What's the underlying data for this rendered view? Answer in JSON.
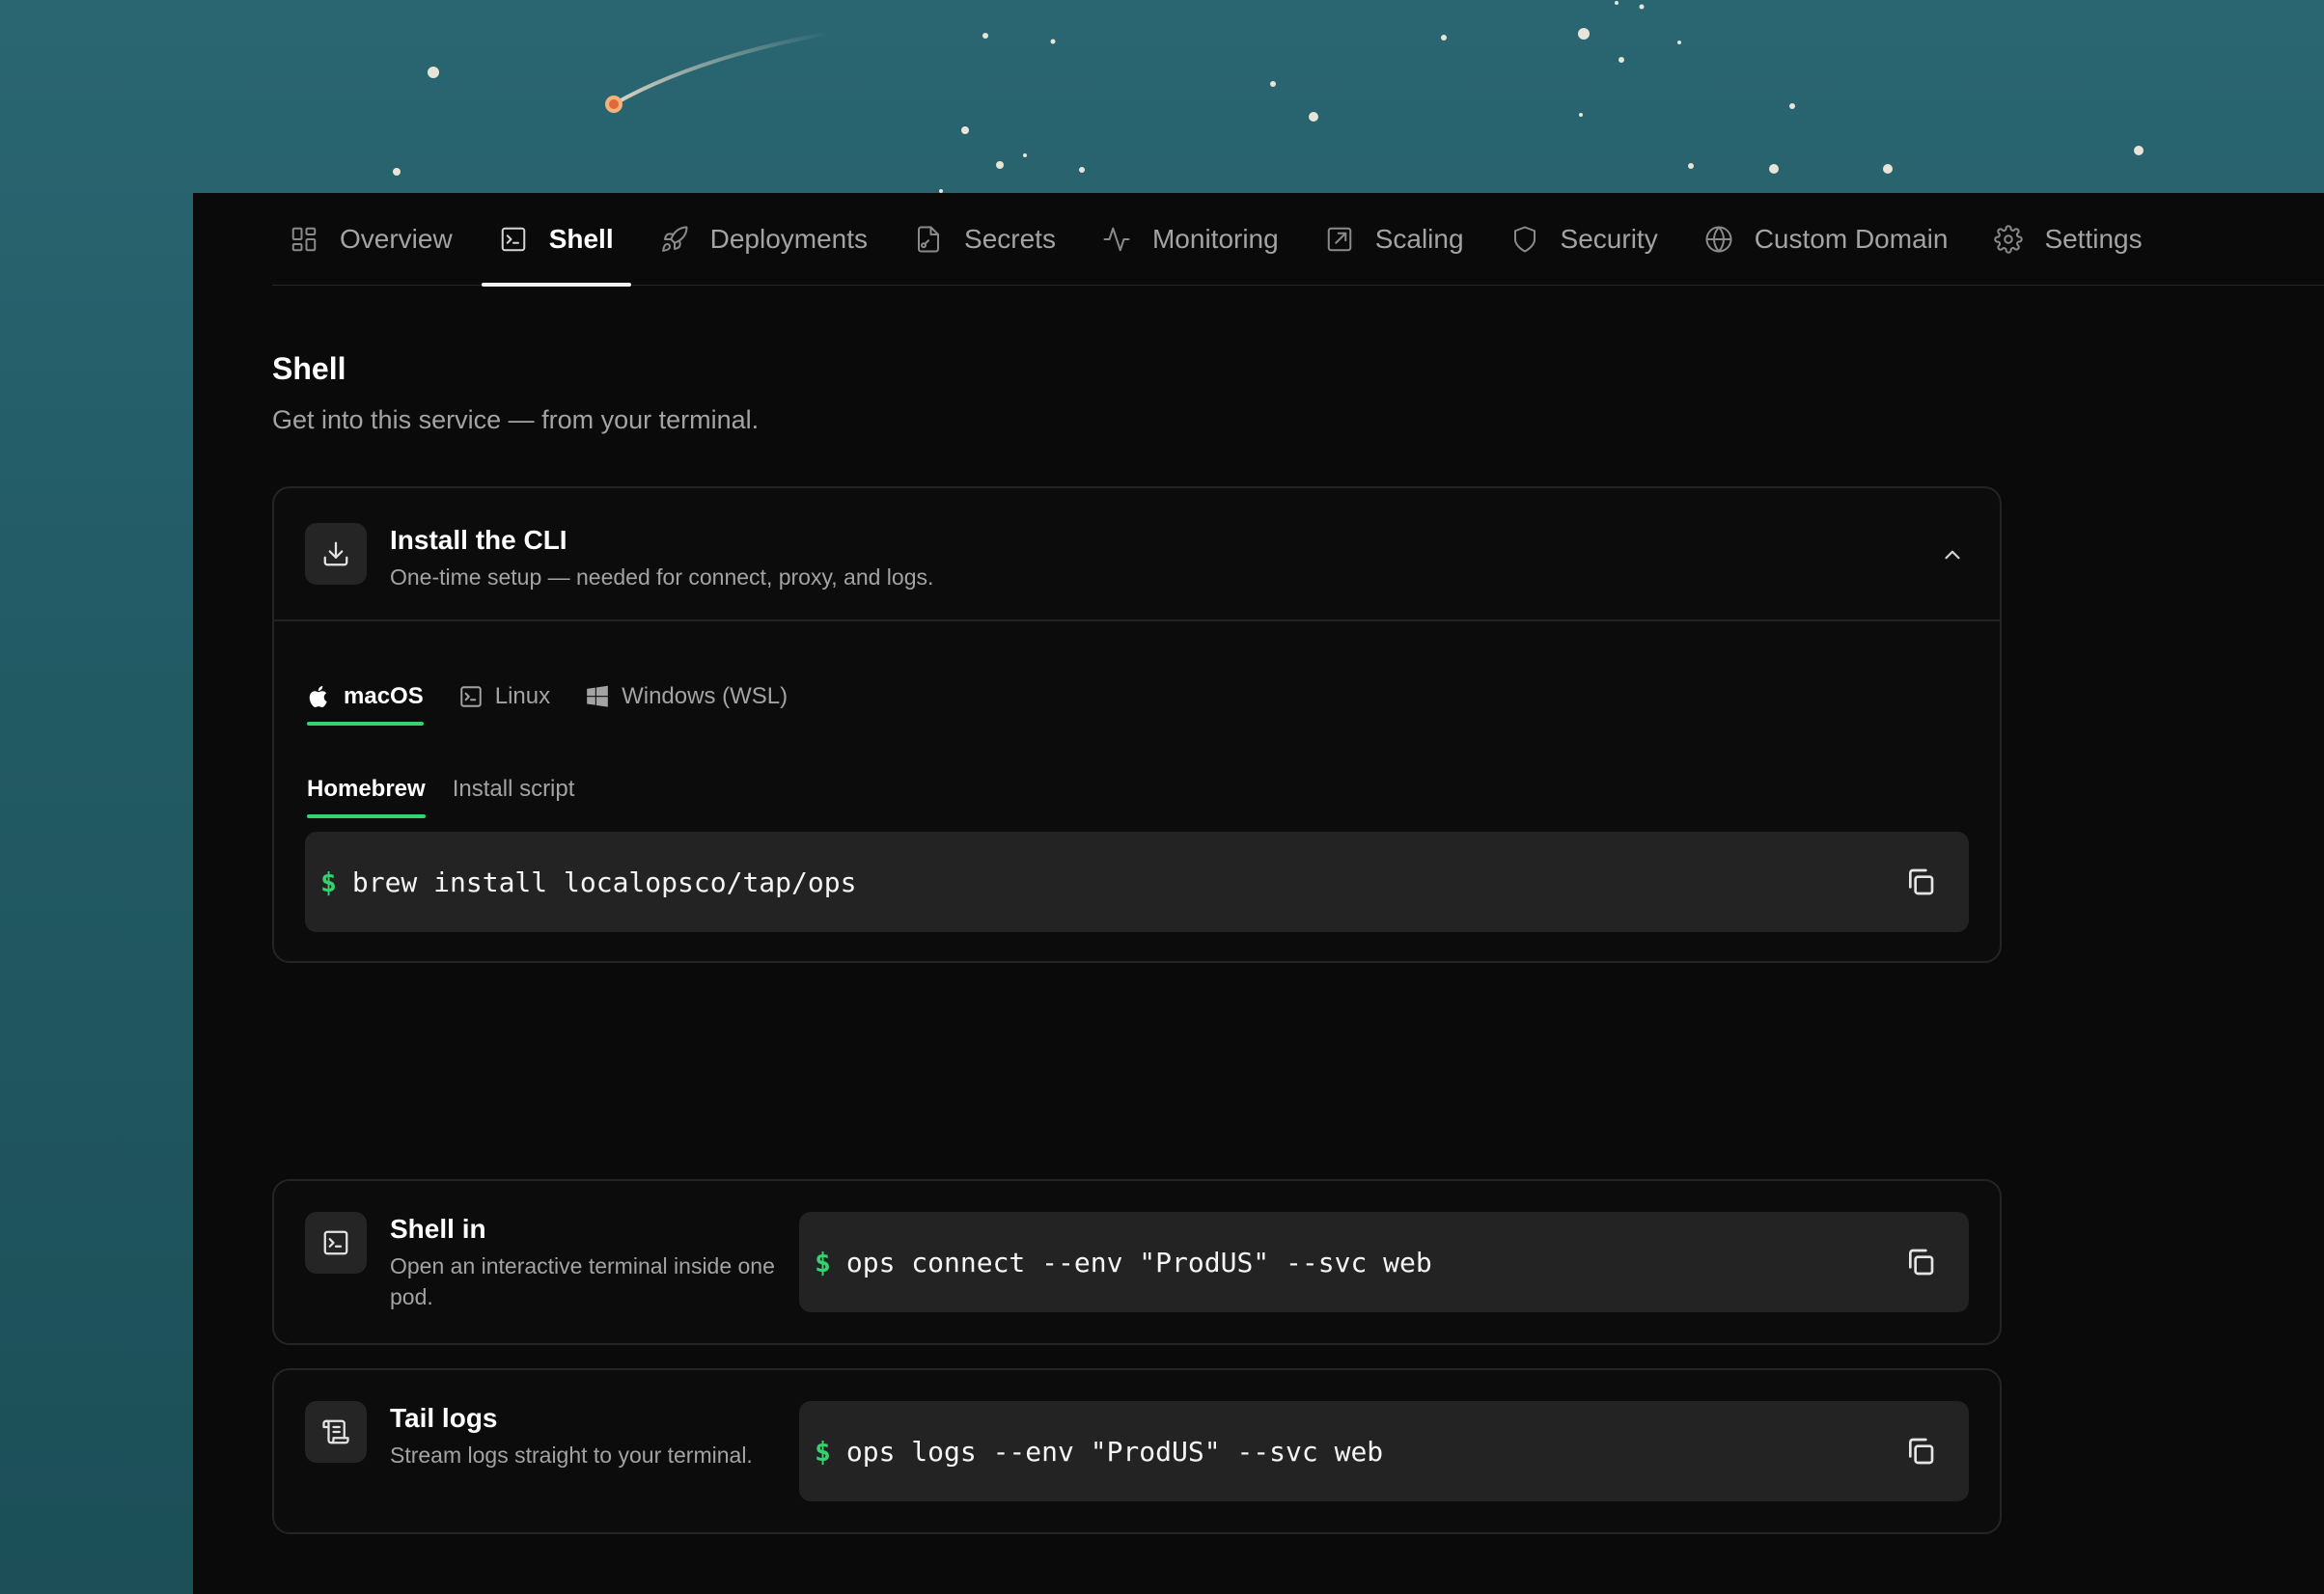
{
  "tabs": [
    {
      "label": "Overview",
      "icon": "grid-icon"
    },
    {
      "label": "Shell",
      "icon": "terminal-icon",
      "active": true
    },
    {
      "label": "Deployments",
      "icon": "rocket-icon"
    },
    {
      "label": "Secrets",
      "icon": "file-key-icon"
    },
    {
      "label": "Monitoring",
      "icon": "activity-icon"
    },
    {
      "label": "Scaling",
      "icon": "external-link-icon"
    },
    {
      "label": "Security",
      "icon": "shield-icon"
    },
    {
      "label": "Custom Domain",
      "icon": "globe-icon"
    },
    {
      "label": "Settings",
      "icon": "gear-icon"
    }
  ],
  "page": {
    "title": "Shell",
    "subtitle": "Get into this service — from your terminal."
  },
  "install": {
    "title": "Install the CLI",
    "description": "One-time setup — needed for connect, proxy, and logs.",
    "os_tabs": [
      {
        "label": "macOS",
        "icon": "apple-icon",
        "active": true
      },
      {
        "label": "Linux",
        "icon": "terminal-icon"
      },
      {
        "label": "Windows (WSL)",
        "icon": "windows-icon"
      }
    ],
    "method_tabs": [
      {
        "label": "Homebrew",
        "active": true
      },
      {
        "label": "Install script"
      }
    ],
    "prompt": "$",
    "command": "brew install localopsco/tap/ops"
  },
  "shell_in": {
    "title": "Shell in",
    "description": "Open an interactive terminal inside one pod.",
    "prompt": "$",
    "command": "ops connect --env \"ProdUS\" --svc web"
  },
  "tail_logs": {
    "title": "Tail logs",
    "description": "Stream logs straight to your terminal.",
    "prompt": "$",
    "command": "ops logs --env \"ProdUS\" --svc web"
  },
  "colors": {
    "accent": "#34d36d",
    "panel_bg": "#0a0a0a",
    "code_bg": "#232323",
    "backdrop": "#235c66"
  }
}
